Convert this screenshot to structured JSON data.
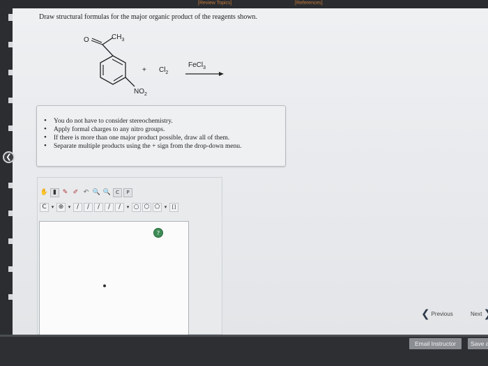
{
  "top_links": {
    "review_topics": "[Review Topics]",
    "references": "[References]"
  },
  "question": "Draw structural formulas for the major organic product of the reagents shown.",
  "reaction": {
    "substituent_top": "CH",
    "substituent_top_sub": "3",
    "carbonyl_o": "O",
    "substituent_bottom": "NO",
    "substituent_bottom_sub": "2",
    "plus": "+",
    "reagent": "Cl",
    "reagent_sub": "2",
    "catalyst": "FeCl",
    "catalyst_sub": "3"
  },
  "instructions": [
    "You do not have to consider stereochemistry.",
    "Apply formal charges to any nitro groups.",
    "If there is more than one major product possible, draw all of them.",
    "Separate multiple products using the + sign from the drop-down menu."
  ],
  "editor": {
    "toolbar1_icons": [
      "hand-icon",
      "eraser-icon",
      "pencil-icon",
      "lasso-icon",
      "undo-icon",
      "zoom-in-icon",
      "zoom-out-icon",
      "template-c-icon",
      "template-p-icon"
    ],
    "toolbar2_items": [
      "C",
      "⊕",
      "/",
      "/",
      "/",
      "/",
      "/",
      "○",
      "⬡",
      "⬠",
      "[]"
    ],
    "help_icon": "help-icon"
  },
  "nav": {
    "previous": "Previous",
    "next": "Next"
  },
  "buttons": {
    "email_instructor": "Email Instructor",
    "save": "Save a"
  },
  "colors": {
    "link": "#c77a3a",
    "help_green": "#3e8c55",
    "button_gray": "#8a8d92"
  }
}
